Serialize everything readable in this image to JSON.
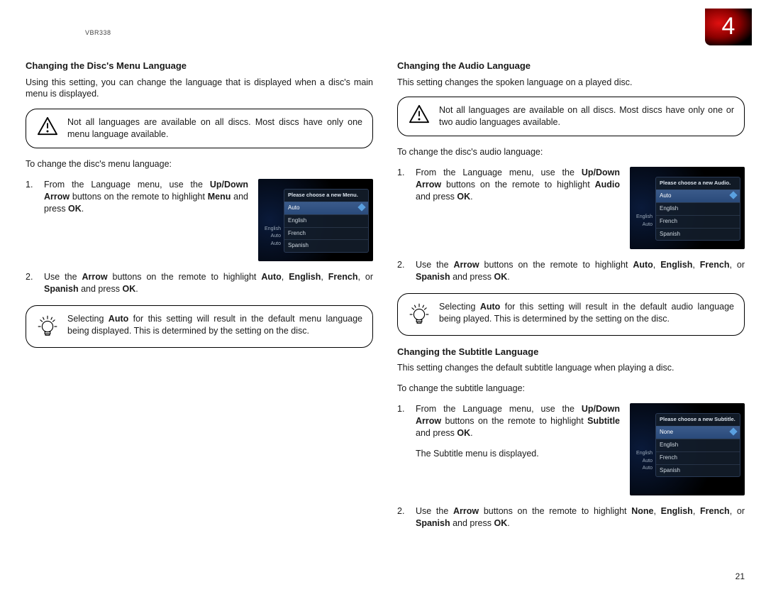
{
  "model": "VBR338",
  "chapter_number": "4",
  "page_number": "21",
  "left": {
    "title": "Changing the Disc's Menu Language",
    "intro": "Using this setting, you can change the language that is displayed when a disc's main menu is displayed.",
    "warning": "Not all languages are available on all discs. Most discs have only one menu language available.",
    "to_change": "To change the disc's menu language:",
    "screenshot": {
      "header": "Please choose a new Menu.",
      "selected": "Auto",
      "options": [
        "Auto",
        "English",
        "French",
        "Spanish"
      ],
      "side": [
        "English",
        "Auto",
        "Auto"
      ]
    },
    "tip": "Selecting <b>Auto</b> for this setting will result in the default menu language being displayed. This is determined by the setting on the disc.",
    "step1": "From the Language menu, use the <b>Up/Down Arrow</b> buttons on the remote to highlight <b>Menu</b> and press <b>OK</b>.",
    "step2": "Use the <b>Arrow</b> buttons on the remote to highlight <b>Auto</b>, <b>English</b>, <b>French</b>, or <b>Spanish</b> and press <b>OK</b>."
  },
  "right_audio": {
    "title": "Changing the Audio Language",
    "intro": "This setting changes the spoken language on a played disc.",
    "warning": "Not all languages are available on all discs. Most discs have only one or two audio languages available.",
    "to_change": "To change the disc's audio language:",
    "screenshot": {
      "header": "Please choose a new Audio.",
      "selected": "Auto",
      "options": [
        "Auto",
        "English",
        "French",
        "Spanish"
      ],
      "side": [
        "English",
        "Auto"
      ]
    },
    "tip": "Selecting <b>Auto</b> for this setting will result in the default audio language being played. This is determined by the setting on the disc.",
    "step1": "From the Language menu, use the <b>Up/Down Arrow</b> buttons on the remote to highlight <b>Audio</b> and press <b>OK</b>.",
    "step2": "Use the <b>Arrow</b> buttons on the remote to highlight <b>Auto</b>, <b>English</b>, <b>French</b>, or <b>Spanish</b> and press <b>OK</b>."
  },
  "right_subtitle": {
    "title": "Changing the Subtitle Language",
    "intro": "This setting changes the default subtitle language when playing a disc.",
    "to_change": "To change the subtitle language:",
    "screenshot": {
      "header": "Please choose a new Subtitle.",
      "selected": "None",
      "options": [
        "None",
        "English",
        "French",
        "Spanish"
      ],
      "side": [
        "English",
        "Auto",
        "Auto"
      ]
    },
    "step1": "From the Language menu, use the <b>Up/Down Arrow</b> buttons on the remote to highlight <b>Subtitle</b> and press <b>OK</b>.",
    "step1b": "The Subtitle menu is displayed.",
    "step2": "Use the <b>Arrow</b> buttons on the remote to highlight <b>None</b>, <b>English</b>, <b>French</b>, or <b>Spanish</b> and press <b>OK</b>."
  }
}
